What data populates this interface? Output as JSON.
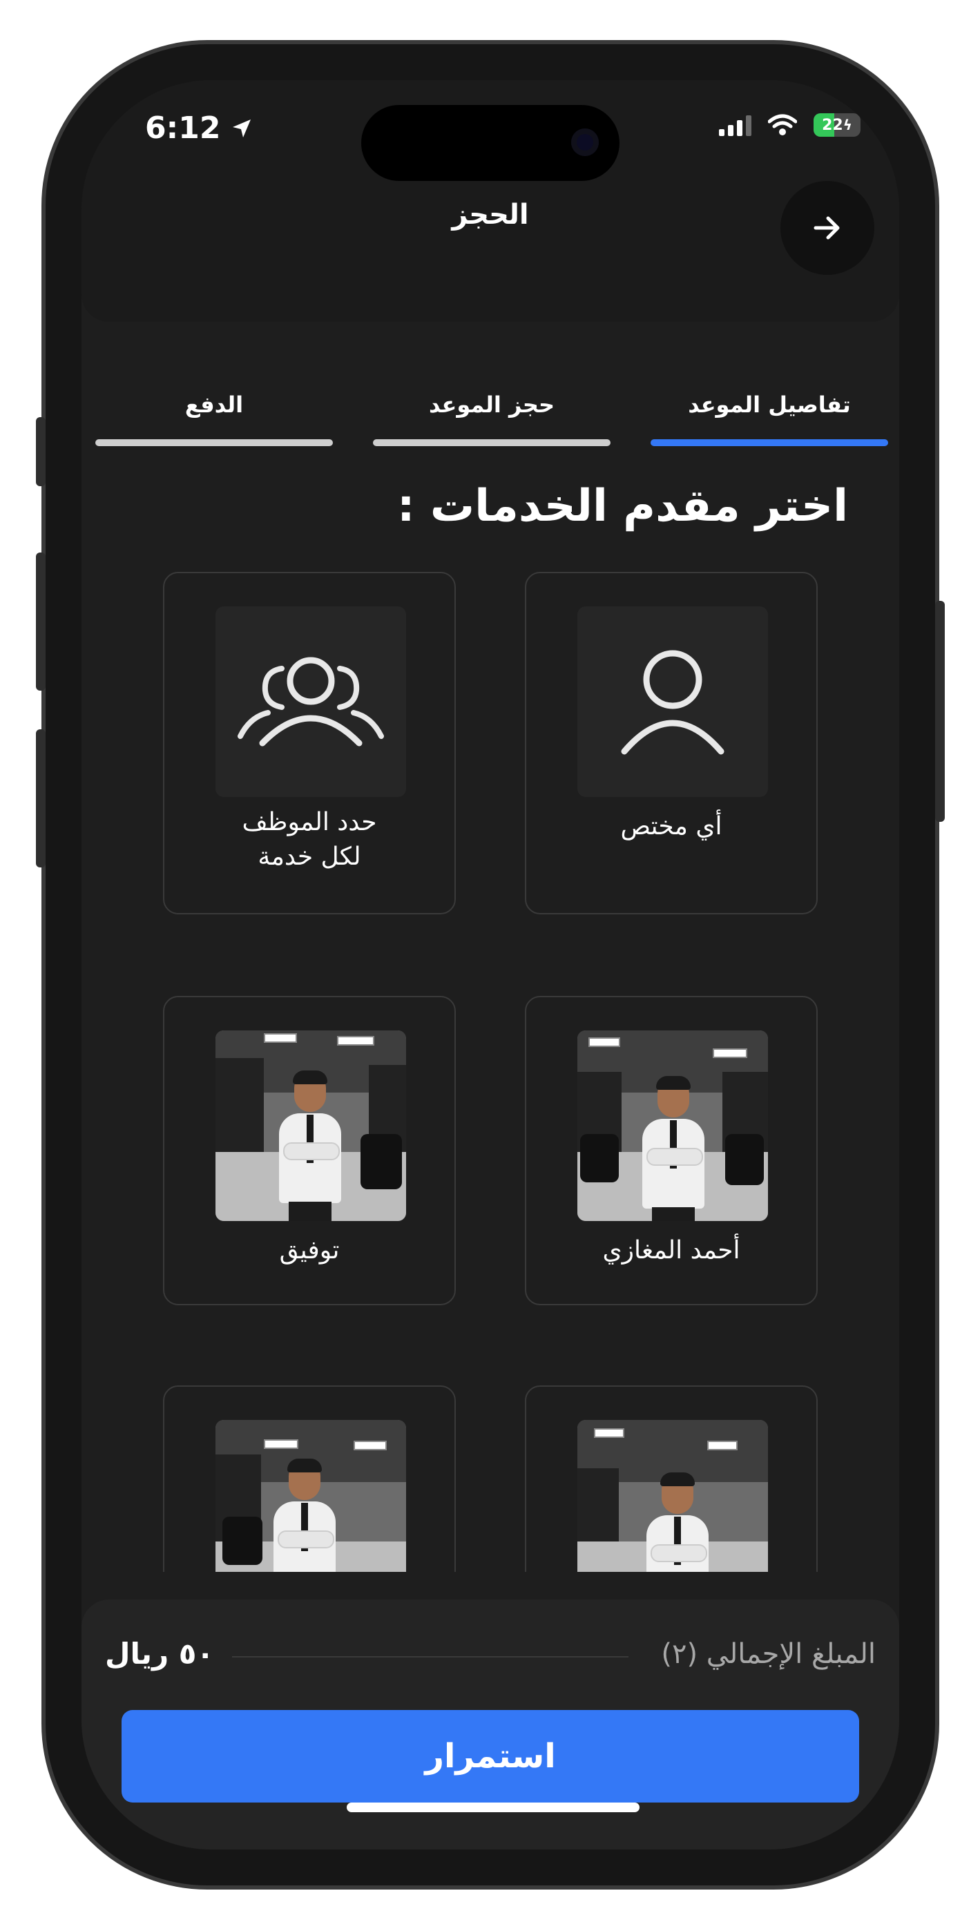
{
  "status_bar": {
    "time": "6:12",
    "battery": "22"
  },
  "header": {
    "title": "الحجز"
  },
  "tabs": [
    {
      "label": "تفاصيل الموعد",
      "active": true
    },
    {
      "label": "حجز الموعد",
      "active": false
    },
    {
      "label": "الدفع",
      "active": false
    }
  ],
  "section_title": "اختر مقدم الخدمات :",
  "providers": {
    "any_specialist": "أي مختص",
    "per_service_line1": "حدد الموظف",
    "per_service_line2": "لكل خدمة",
    "staff_1": "أحمد المغازي",
    "staff_2": "توفيق"
  },
  "footer": {
    "total_label": "المبلغ الإجمالي (٢)",
    "total_amount": "٥٠ ريال",
    "continue_label": "استمرار"
  },
  "colors": {
    "accent": "#3478f6",
    "background": "#1e1e1e",
    "battery_green": "#34c759"
  }
}
